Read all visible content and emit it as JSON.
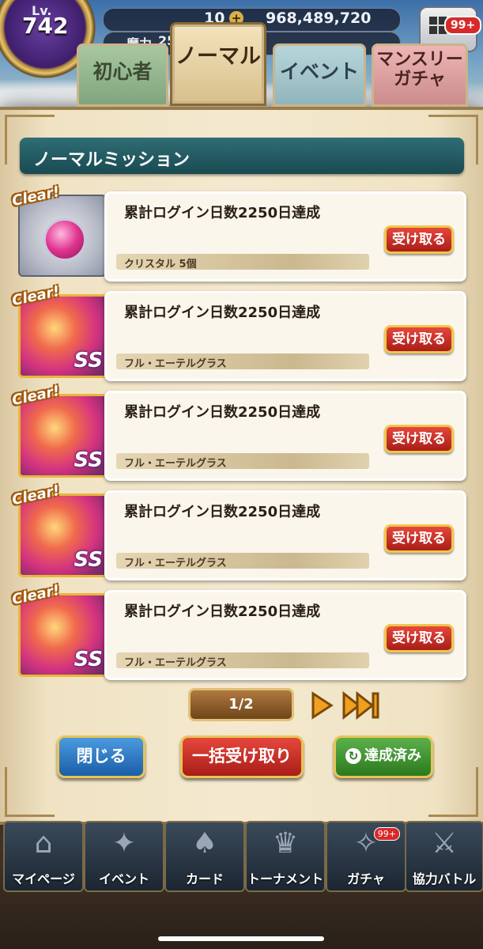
{
  "header": {
    "level_label": "Lv.",
    "level_value": "742",
    "crystal_count": "10",
    "gold_amount": "968,489,720",
    "mana_label": "魔力",
    "mana_value": "25",
    "mail_badge": "99+"
  },
  "tabs": [
    {
      "label": "初心者"
    },
    {
      "label": "ノーマル"
    },
    {
      "label": "イベント"
    },
    {
      "label": "マンスリーガチャ"
    }
  ],
  "panel": {
    "title": "ノーマルミッション"
  },
  "missions": [
    {
      "clear": "Clear!",
      "title": "累計ログイン日数2250日達成",
      "reward": "クリスタル 5個",
      "button": "受け取る"
    },
    {
      "clear": "Clear!",
      "title": "累計ログイン日数2250日達成",
      "reward": "フル・エーテルグラス",
      "button": "受け取る"
    },
    {
      "clear": "Clear!",
      "title": "累計ログイン日数2250日達成",
      "reward": "フル・エーテルグラス",
      "button": "受け取る"
    },
    {
      "clear": "Clear!",
      "title": "累計ログイン日数2250日達成",
      "reward": "フル・エーテルグラス",
      "button": "受け取る"
    },
    {
      "clear": "Clear!",
      "title": "累計ログイン日数2250日達成",
      "reward": "フル・エーテルグラス",
      "button": "受け取る"
    }
  ],
  "pager": {
    "text": "1/2"
  },
  "buttons": {
    "close": "閉じる",
    "claim_all": "一括受け取り",
    "achieved": "達成済み"
  },
  "nav": [
    {
      "label": "マイページ",
      "icon": "house-icon"
    },
    {
      "label": "イベント",
      "icon": "event-icon"
    },
    {
      "label": "カード",
      "icon": "cards-icon"
    },
    {
      "label": "トーナメント",
      "icon": "trophy-icon"
    },
    {
      "label": "ガチャ",
      "icon": "gacha-icon",
      "badge": "99+"
    },
    {
      "label": "協力バトル",
      "icon": "battle-icon"
    }
  ],
  "colors": {
    "header_bar": "#1a4a52",
    "claim_button": "#c0281f",
    "close_button": "#1b5ea8",
    "achieved_button": "#2b7a1e",
    "panel_bg": "#f4e9cf"
  }
}
